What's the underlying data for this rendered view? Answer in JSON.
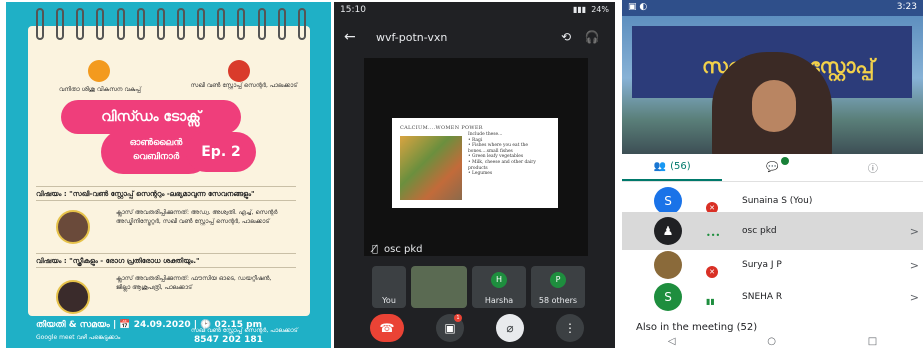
{
  "poster": {
    "org_left": "വനിതാ ശിശു വികസന വകുപ്പ്",
    "org_right": "സഖി വൺ സ്റ്റോപ്പ് സെന്റർ, പാലക്കാട്",
    "title": "വിസ്ഡം ടോക്സ്",
    "subtitle_line1": "ഓൺലൈൻ",
    "subtitle_line2": "വെബിനാർ",
    "episode": "Ep. 2",
    "topic1": "വിഷയം : \"സഖി-വൺ സ്റ്റോപ്പ് സെന്ററും -ലഭ്യമാവുന്ന സേവനങ്ങളും\"",
    "speaker1": "ക്ലാസ് അവതരിപ്പിക്കുന്നത്: അഡ്വ. അശ്വതി. എച്ച്, സെന്റർ അഡ്മിനിസ്ട്രേറ്റർ, സഖി വൺ സ്റ്റോപ്പ് സെന്റർ, പാലക്കാട്",
    "topic2": "വിഷയം : \"സ്ത്രീകളും - രോഗ പ്രതിരോധ ശക്തിയും.\"",
    "speaker2": "ക്ലാസ് അവതരിപ്പിക്കുന്നത്: ഫൗസിയ ഓടെ, ഡയറ്റീഷൻ, ജില്ലാ ആശുപത്രി, പാലക്കാട്",
    "date_time": "തിയതി & സമയം | 📅 24.09.2020 | 🕑 02.15 pm",
    "footer_left": "Google meet വഴി പങ്കെടുക്കാം",
    "footer_right": "സഖി വൺ സ്റ്റോപ്പ് സെന്റർ, പാലക്കാട്",
    "phone": "8547 202 181"
  },
  "meet": {
    "time": "15:10",
    "battery": "24%",
    "meeting_code": "wvf-potn-vxn",
    "presenter_label": "osc pkd",
    "slide": {
      "title": "CALCIUM....WOMEN POWER",
      "items": [
        "Include these...",
        "• Ragi",
        "• Fishes where you eat the bones....small fishes",
        "• Green leafy vegetables",
        "• Milk, cheese and other dairy products",
        "• Legumes"
      ]
    },
    "tiles": [
      {
        "label": "You",
        "initial": ""
      },
      {
        "label": "",
        "initial": ""
      },
      {
        "label": "Harsha",
        "initial": "H",
        "color": "#1e8e3e"
      },
      {
        "label": "58 others",
        "initial": "P",
        "color": "#1e8e3e"
      }
    ],
    "chat_badge_count": "1"
  },
  "participants": {
    "time": "3:23",
    "people_tab": "(56)",
    "chat_badge": "1",
    "rows": [
      {
        "name": "Sunaina S (You)",
        "initial": "S",
        "color": "#1a73e8"
      },
      {
        "name": "osc pkd",
        "initial": "",
        "color": "#202124"
      },
      {
        "name": "Surya J P",
        "initial": "",
        "color": "#8a6a3a"
      },
      {
        "name": "SNEHA R",
        "initial": "S",
        "color": "#1e8e3e"
      }
    ],
    "also_label": "Also in the meeting (52)",
    "banner_text": "സഖി വൺ സ്റ്റോപ്പ്"
  }
}
